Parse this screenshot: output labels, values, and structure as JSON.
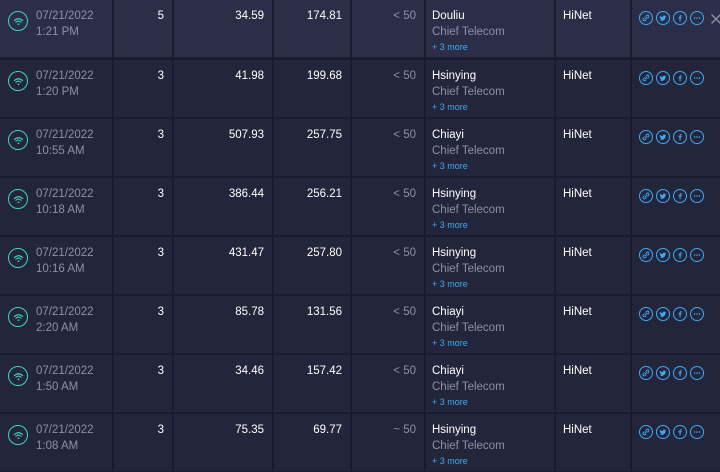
{
  "results": [
    {
      "date": "07/21/2022",
      "time": "1:21 PM",
      "connections": "5",
      "download": "34.59",
      "upload": "174.81",
      "ping": "< 50",
      "server": "Douliu",
      "sponsor": "Chief Telecom",
      "more": "+ 3 more",
      "isp": "HiNet",
      "highlight": true
    },
    {
      "date": "07/21/2022",
      "time": "1:20 PM",
      "connections": "3",
      "download": "41.98",
      "upload": "199.68",
      "ping": "< 50",
      "server": "Hsinying",
      "sponsor": "Chief Telecom",
      "more": "+ 3 more",
      "isp": "HiNet",
      "highlight": false
    },
    {
      "date": "07/21/2022",
      "time": "10:55 AM",
      "connections": "3",
      "download": "507.93",
      "upload": "257.75",
      "ping": "< 50",
      "server": "Chiayi",
      "sponsor": "Chief Telecom",
      "more": "+ 3 more",
      "isp": "HiNet",
      "highlight": false
    },
    {
      "date": "07/21/2022",
      "time": "10:18 AM",
      "connections": "3",
      "download": "386.44",
      "upload": "256.21",
      "ping": "< 50",
      "server": "Hsinying",
      "sponsor": "Chief Telecom",
      "more": "+ 3 more",
      "isp": "HiNet",
      "highlight": false
    },
    {
      "date": "07/21/2022",
      "time": "10:16 AM",
      "connections": "3",
      "download": "431.47",
      "upload": "257.80",
      "ping": "< 50",
      "server": "Hsinying",
      "sponsor": "Chief Telecom",
      "more": "+ 3 more",
      "isp": "HiNet",
      "highlight": false
    },
    {
      "date": "07/21/2022",
      "time": "2:20 AM",
      "connections": "3",
      "download": "85.78",
      "upload": "131.56",
      "ping": "< 50",
      "server": "Chiayi",
      "sponsor": "Chief Telecom",
      "more": "+ 3 more",
      "isp": "HiNet",
      "highlight": false
    },
    {
      "date": "07/21/2022",
      "time": "1:50 AM",
      "connections": "3",
      "download": "34.46",
      "upload": "157.42",
      "ping": "< 50",
      "server": "Chiayi",
      "sponsor": "Chief Telecom",
      "more": "+ 3 more",
      "isp": "HiNet",
      "highlight": false
    },
    {
      "date": "07/21/2022",
      "time": "1:08 AM",
      "connections": "3",
      "download": "75.35",
      "upload": "69.77",
      "ping": "~ 50",
      "server": "Hsinying",
      "sponsor": "Chief Telecom",
      "more": "+ 3 more",
      "isp": "HiNet",
      "highlight": false
    }
  ],
  "row_icon": "wifi-icon",
  "action_icons": [
    "link-icon",
    "twitter-icon",
    "facebook-icon",
    "more-icon"
  ],
  "colors": {
    "background": "#1a1b2e",
    "row": "#23253a",
    "row_highlight": "#2c2e47",
    "wifi_accent": "#3fd3c3",
    "link_accent": "#3fa9f5"
  }
}
